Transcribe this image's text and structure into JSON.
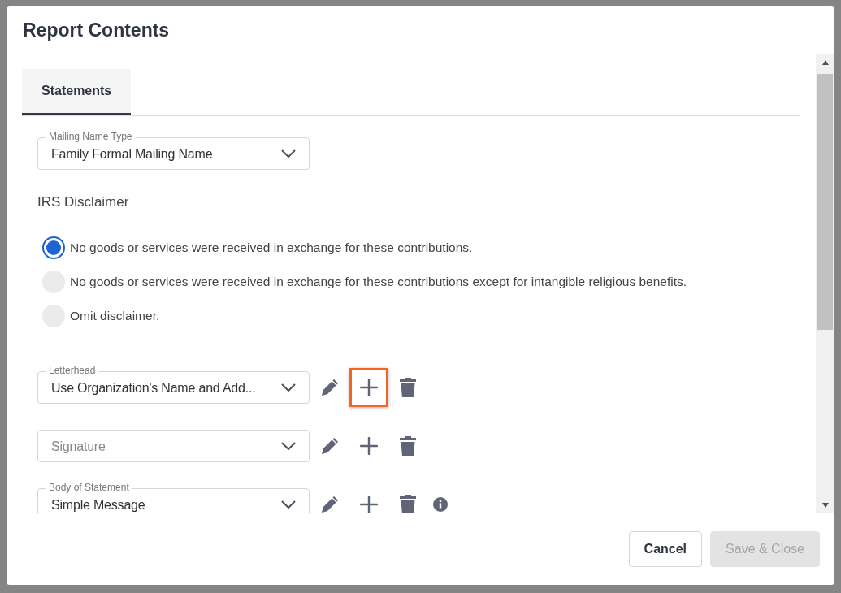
{
  "dialog": {
    "title": "Report Contents"
  },
  "tabs": [
    {
      "label": "Statements",
      "selected": true
    }
  ],
  "mailing_name_type": {
    "label": "Mailing Name Type",
    "value": "Family Formal Mailing Name"
  },
  "irs_disclaimer": {
    "label": "IRS Disclaimer",
    "options": [
      {
        "label": "No goods or services were received in exchange for these contributions.",
        "selected": true
      },
      {
        "label": "No goods or services were received in exchange for these contributions except for intangible religious benefits.",
        "selected": false
      },
      {
        "label": "Omit disclaimer.",
        "selected": false
      }
    ]
  },
  "selects": [
    {
      "label": "Letterhead",
      "value": "Use Organization's Name and Add...",
      "actions": [
        {
          "kind": "edit",
          "highlighted": false
        },
        {
          "kind": "add",
          "highlighted": true
        },
        {
          "kind": "delete",
          "highlighted": false
        }
      ]
    },
    {
      "placeholder": "Signature",
      "actions": [
        {
          "kind": "edit",
          "highlighted": false
        },
        {
          "kind": "add",
          "highlighted": false
        },
        {
          "kind": "delete",
          "highlighted": false
        }
      ]
    },
    {
      "label": "Body of Statement",
      "value": "Simple Message",
      "actions": [
        {
          "kind": "edit",
          "highlighted": false
        },
        {
          "kind": "add",
          "highlighted": false
        },
        {
          "kind": "delete",
          "highlighted": false
        },
        {
          "kind": "info",
          "highlighted": false
        }
      ]
    }
  ],
  "buttons": [
    {
      "label": "Cancel",
      "disabled": false
    },
    {
      "label": "Save & Close",
      "disabled": true
    }
  ]
}
